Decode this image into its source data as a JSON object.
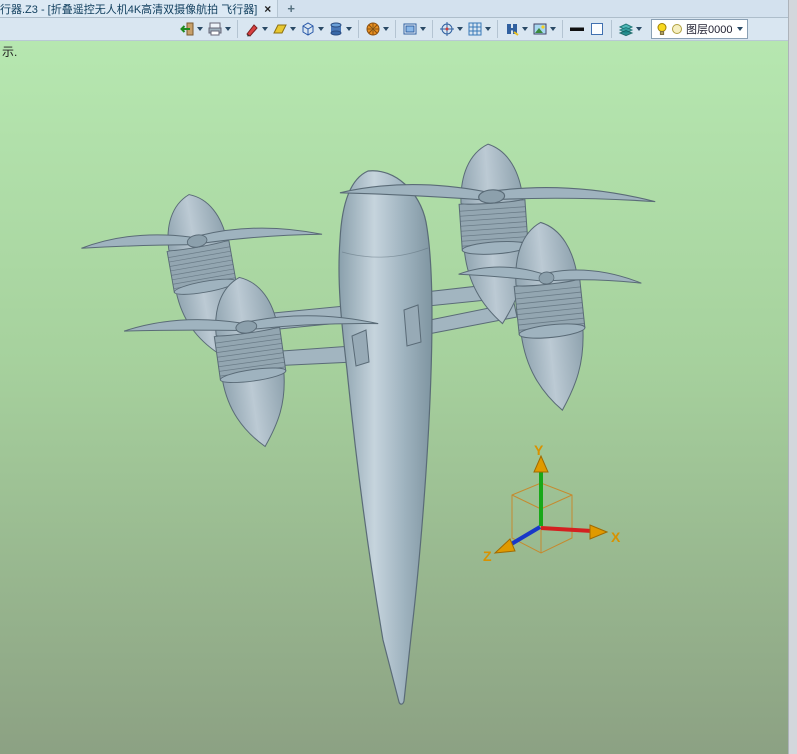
{
  "window": {
    "tab_title": "行器.Z3 - [折叠遥控无人机4K高清双摄像航拍 飞行器]",
    "close_label": "×",
    "new_tab_label": "+"
  },
  "prompt": {
    "text": "示."
  },
  "toolbar": {
    "layer_value": "图层0000",
    "icons": [
      "exit-icon",
      "print-icon",
      "pen-icon",
      "sketch-plane-icon",
      "wireframe-cube-icon",
      "solid-view-icon",
      "color-wheel-icon",
      "display-mode-icon",
      "target-icon",
      "grid-icon",
      "hatch-icon",
      "render-image-icon",
      "line-width-icon",
      "face-color-icon",
      "layers-icon",
      "bulb-icon",
      "layer-color-swatch-icon",
      "chevron-down-icon"
    ]
  },
  "viewport": {
    "model": "folding-quadcopter-drone",
    "triad": {
      "x": "X",
      "y": "Y",
      "z": "Z"
    },
    "colors": {
      "bg_top": "#b6e7b0",
      "bg_bottom": "#8ca183",
      "model_fill": "#a9bcc7",
      "model_outline": "#5a6b77",
      "axis_x": "#d42020",
      "axis_y": "#18a818",
      "axis_z": "#1838c8",
      "axis_label": "#d89200"
    }
  }
}
